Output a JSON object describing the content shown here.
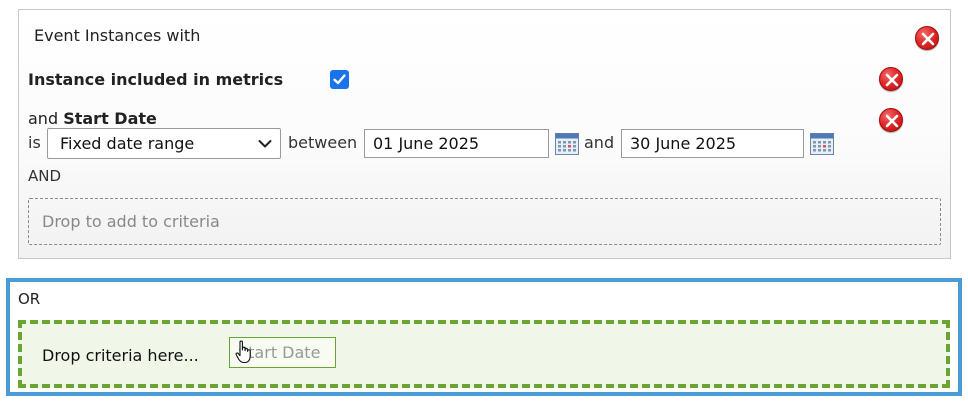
{
  "group": {
    "title": "Event Instances with",
    "criteria": [
      {
        "label": "Instance included in metrics",
        "checked": true
      },
      {
        "prefix": "and",
        "label": "Start Date",
        "operator_prefix": "is",
        "selected_option": "Fixed date range",
        "between_label": "between",
        "start_date": "01 June 2025",
        "and_label": "and",
        "end_date": "30 June 2025"
      }
    ],
    "and_label": "AND",
    "drop_placeholder": "Drop to add to criteria"
  },
  "or_group": {
    "label": "OR",
    "drop_hint": "Drop criteria here...",
    "dragging_chip": "Start Date"
  },
  "colors": {
    "remove_red": "#e02a2a",
    "checkbox_blue": "#1a73e8",
    "or_border": "#4a9bd3",
    "drop_green": "#6aa532"
  },
  "icons": {
    "remove": "remove-icon",
    "checkmark": "checkmark-icon",
    "calendar": "calendar-icon",
    "dropdown": "chevron-down-icon",
    "cursor": "hand-cursor-icon"
  }
}
